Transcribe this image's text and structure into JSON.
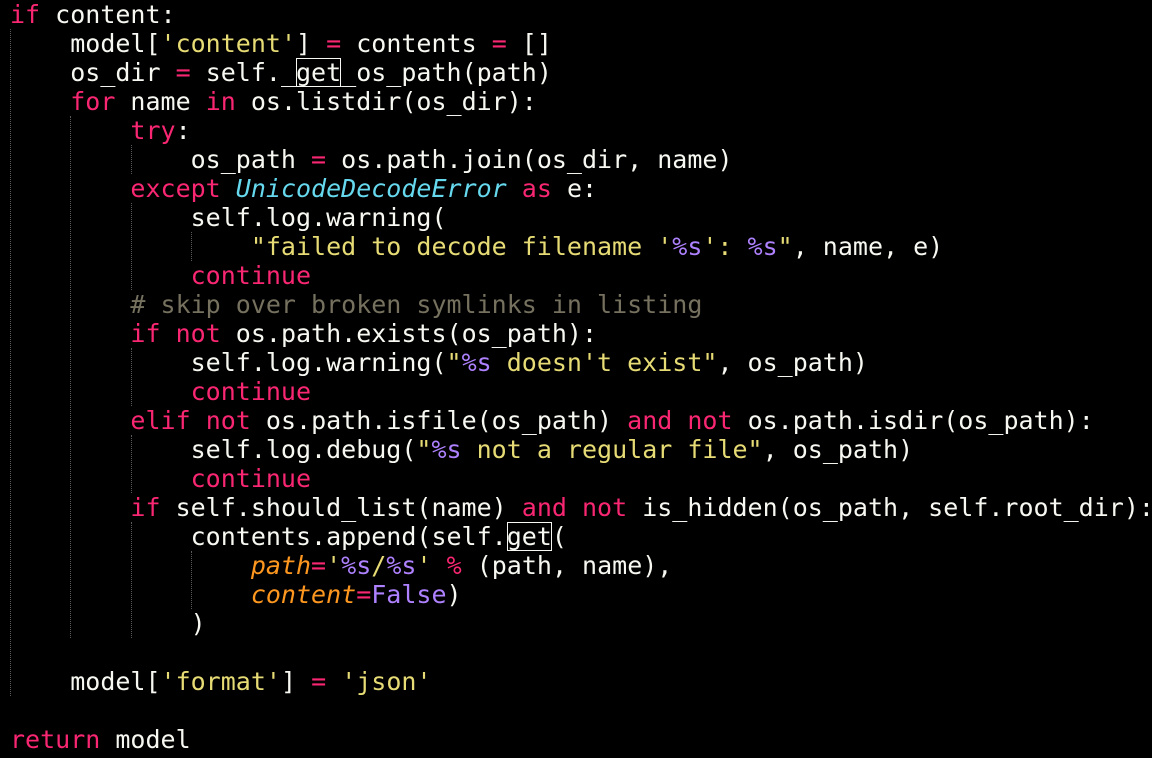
{
  "theme": {
    "background": "#000000",
    "foreground": "#f8f8f2",
    "keyword": "#f92672",
    "string": "#e6db74",
    "format_specifier": "#ae81ff",
    "constant": "#ae81ff",
    "comment": "#75715e",
    "class_name": "#66d9ef",
    "keyword_argument": "#fd971f",
    "match_highlight_border": "#f8f8f2"
  },
  "editor": {
    "language": "python",
    "lines": [
      {
        "indent": 0,
        "tokens": [
          {
            "t": "if",
            "c": "kw"
          },
          {
            "t": " content:",
            "c": "plain"
          }
        ]
      },
      {
        "indent": 4,
        "tokens": [
          {
            "t": "model[",
            "c": "plain"
          },
          {
            "t": "'content'",
            "c": "str"
          },
          {
            "t": "] ",
            "c": "plain"
          },
          {
            "t": "=",
            "c": "op"
          },
          {
            "t": " contents ",
            "c": "plain"
          },
          {
            "t": "=",
            "c": "op"
          },
          {
            "t": " []",
            "c": "plain"
          }
        ]
      },
      {
        "indent": 4,
        "tokens": [
          {
            "t": "os_dir ",
            "c": "plain"
          },
          {
            "t": "=",
            "c": "op"
          },
          {
            "t": " self._",
            "c": "plain"
          },
          {
            "t": "get",
            "c": "plain",
            "box": true
          },
          {
            "t": "_os_path(path)",
            "c": "plain"
          }
        ]
      },
      {
        "indent": 4,
        "tokens": [
          {
            "t": "for",
            "c": "kw"
          },
          {
            "t": " name ",
            "c": "plain"
          },
          {
            "t": "in",
            "c": "kw"
          },
          {
            "t": " os.listdir(os_dir):",
            "c": "plain"
          }
        ]
      },
      {
        "indent": 8,
        "tokens": [
          {
            "t": "try",
            "c": "kw"
          },
          {
            "t": ":",
            "c": "plain"
          }
        ]
      },
      {
        "indent": 12,
        "tokens": [
          {
            "t": "os_path ",
            "c": "plain"
          },
          {
            "t": "=",
            "c": "op"
          },
          {
            "t": " os.path.join(os_dir, name)",
            "c": "plain"
          }
        ]
      },
      {
        "indent": 8,
        "tokens": [
          {
            "t": "except",
            "c": "kw"
          },
          {
            "t": " ",
            "c": "plain"
          },
          {
            "t": "UnicodeDecodeError",
            "c": "cls"
          },
          {
            "t": " ",
            "c": "plain"
          },
          {
            "t": "as",
            "c": "kw"
          },
          {
            "t": " e:",
            "c": "plain"
          }
        ]
      },
      {
        "indent": 12,
        "tokens": [
          {
            "t": "self.log.warning(",
            "c": "plain"
          }
        ]
      },
      {
        "indent": 16,
        "tokens": [
          {
            "t": "\"failed to decode filename '",
            "c": "str"
          },
          {
            "t": "%s",
            "c": "fmt"
          },
          {
            "t": "': ",
            "c": "str"
          },
          {
            "t": "%s",
            "c": "fmt"
          },
          {
            "t": "\"",
            "c": "str"
          },
          {
            "t": ", name, e)",
            "c": "plain"
          }
        ]
      },
      {
        "indent": 12,
        "tokens": [
          {
            "t": "continue",
            "c": "kw"
          }
        ]
      },
      {
        "indent": 8,
        "tokens": [
          {
            "t": "# skip over broken symlinks in listing",
            "c": "cmt"
          }
        ]
      },
      {
        "indent": 8,
        "tokens": [
          {
            "t": "if",
            "c": "kw"
          },
          {
            "t": " ",
            "c": "plain"
          },
          {
            "t": "not",
            "c": "kw"
          },
          {
            "t": " os.path.exists(os_path):",
            "c": "plain"
          }
        ]
      },
      {
        "indent": 12,
        "tokens": [
          {
            "t": "self.log.warning(",
            "c": "plain"
          },
          {
            "t": "\"",
            "c": "str"
          },
          {
            "t": "%s",
            "c": "fmt"
          },
          {
            "t": " doesn't exist\"",
            "c": "str"
          },
          {
            "t": ", os_path)",
            "c": "plain"
          }
        ]
      },
      {
        "indent": 12,
        "tokens": [
          {
            "t": "continue",
            "c": "kw"
          }
        ]
      },
      {
        "indent": 8,
        "tokens": [
          {
            "t": "elif",
            "c": "kw"
          },
          {
            "t": " ",
            "c": "plain"
          },
          {
            "t": "not",
            "c": "kw"
          },
          {
            "t": " os.path.isfile(os_path) ",
            "c": "plain"
          },
          {
            "t": "and",
            "c": "kw"
          },
          {
            "t": " ",
            "c": "plain"
          },
          {
            "t": "not",
            "c": "kw"
          },
          {
            "t": " os.path.isdir(os_path):",
            "c": "plain"
          }
        ]
      },
      {
        "indent": 12,
        "tokens": [
          {
            "t": "self.log.debug(",
            "c": "plain"
          },
          {
            "t": "\"",
            "c": "str"
          },
          {
            "t": "%s",
            "c": "fmt"
          },
          {
            "t": " not a regular file\"",
            "c": "str"
          },
          {
            "t": ", os_path)",
            "c": "plain"
          }
        ]
      },
      {
        "indent": 12,
        "tokens": [
          {
            "t": "continue",
            "c": "kw"
          }
        ]
      },
      {
        "indent": 8,
        "tokens": [
          {
            "t": "if",
            "c": "kw"
          },
          {
            "t": " self.should_list(name) ",
            "c": "plain"
          },
          {
            "t": "and",
            "c": "kw"
          },
          {
            "t": " ",
            "c": "plain"
          },
          {
            "t": "not",
            "c": "kw"
          },
          {
            "t": " is_hidden(os_path, self.root_dir):",
            "c": "plain"
          }
        ]
      },
      {
        "indent": 12,
        "tokens": [
          {
            "t": "contents.append(self.",
            "c": "plain"
          },
          {
            "t": "get",
            "c": "plain",
            "box": true
          },
          {
            "t": "(",
            "c": "plain"
          }
        ]
      },
      {
        "indent": 16,
        "tokens": [
          {
            "t": "path",
            "c": "kwarg"
          },
          {
            "t": "=",
            "c": "op"
          },
          {
            "t": "'",
            "c": "str"
          },
          {
            "t": "%s",
            "c": "fmt"
          },
          {
            "t": "/",
            "c": "str"
          },
          {
            "t": "%s",
            "c": "fmt"
          },
          {
            "t": "'",
            "c": "str"
          },
          {
            "t": " ",
            "c": "plain"
          },
          {
            "t": "%",
            "c": "op"
          },
          {
            "t": " (path, name),",
            "c": "plain"
          }
        ]
      },
      {
        "indent": 16,
        "tokens": [
          {
            "t": "content",
            "c": "kwarg"
          },
          {
            "t": "=",
            "c": "op"
          },
          {
            "t": "False",
            "c": "num"
          },
          {
            "t": ")",
            "c": "plain"
          }
        ]
      },
      {
        "indent": 12,
        "tokens": [
          {
            "t": ")",
            "c": "plain"
          }
        ]
      },
      {
        "indent": 0,
        "tokens": []
      },
      {
        "indent": 4,
        "tokens": [
          {
            "t": "model[",
            "c": "plain"
          },
          {
            "t": "'format'",
            "c": "str"
          },
          {
            "t": "] ",
            "c": "plain"
          },
          {
            "t": "=",
            "c": "op"
          },
          {
            "t": " ",
            "c": "plain"
          },
          {
            "t": "'json'",
            "c": "str"
          }
        ]
      },
      {
        "indent": 0,
        "tokens": []
      },
      {
        "indent": 0,
        "tokens": [
          {
            "t": "return",
            "c": "kw"
          },
          {
            "t": " model",
            "c": "plain"
          }
        ]
      }
    ]
  }
}
